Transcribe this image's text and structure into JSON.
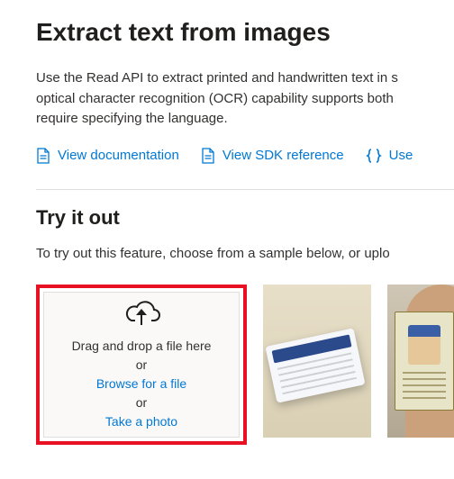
{
  "header": {
    "title": "Extract text from images"
  },
  "description": {
    "line1": "Use the Read API to extract printed and handwritten text in s",
    "line2": "optical character recognition (OCR) capability supports both",
    "line3": "require specifying the language."
  },
  "links": {
    "doc": "View documentation",
    "sdk": "View SDK reference",
    "use": "Use"
  },
  "tryout": {
    "heading": "Try it out",
    "sub": "To try out this feature, choose from a sample below, or uplo"
  },
  "dropzone": {
    "drag": "Drag and drop a file here",
    "or1": "or",
    "browse": "Browse for a file",
    "or2": "or",
    "photo": "Take a photo"
  },
  "samples": [
    {
      "name": "sample-card"
    },
    {
      "name": "sample-id"
    }
  ]
}
